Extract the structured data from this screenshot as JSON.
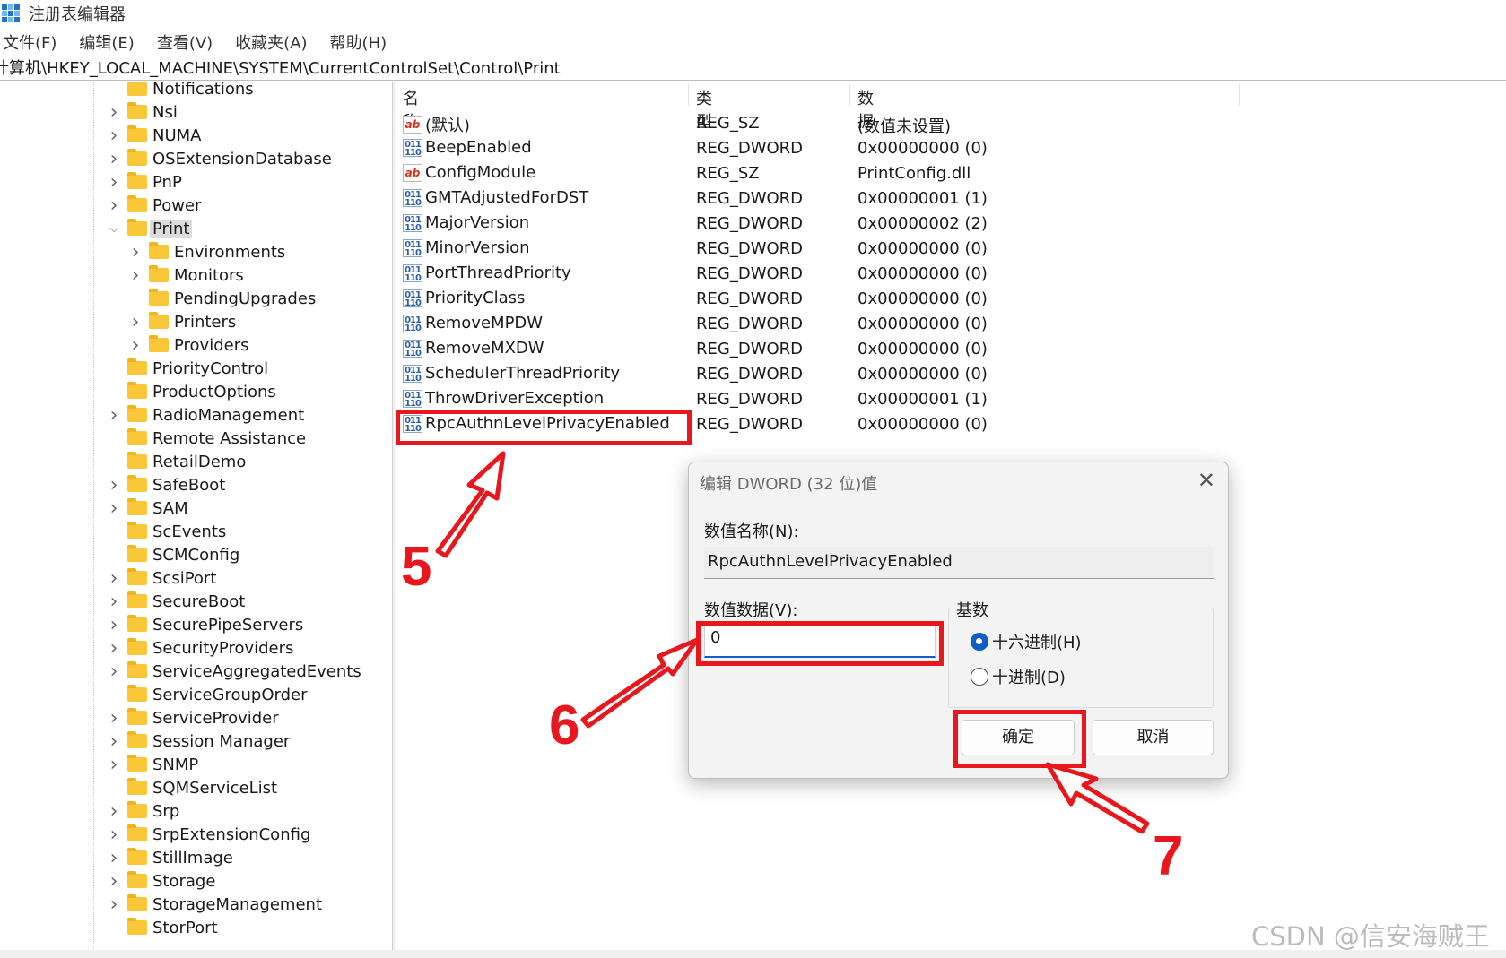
{
  "window": {
    "title": "注册表编辑器",
    "icon": "registry-grid-icon"
  },
  "menu": [
    "文件(F)",
    "编辑(E)",
    "查看(V)",
    "收藏夹(A)",
    "帮助(H)"
  ],
  "address": "计算机\\HKEY_LOCAL_MACHINE\\SYSTEM\\CurrentControlSet\\Control\\Print",
  "tree": [
    {
      "label": "Notifications",
      "level": 0,
      "chevron": "",
      "selected": false
    },
    {
      "label": "Nsi",
      "level": 0,
      "chevron": "right",
      "selected": false
    },
    {
      "label": "NUMA",
      "level": 0,
      "chevron": "right",
      "selected": false
    },
    {
      "label": "OSExtensionDatabase",
      "level": 0,
      "chevron": "right",
      "selected": false
    },
    {
      "label": "PnP",
      "level": 0,
      "chevron": "right",
      "selected": false
    },
    {
      "label": "Power",
      "level": 0,
      "chevron": "right",
      "selected": false
    },
    {
      "label": "Print",
      "level": 0,
      "chevron": "down",
      "selected": true
    },
    {
      "label": "Environments",
      "level": 1,
      "chevron": "right",
      "selected": false
    },
    {
      "label": "Monitors",
      "level": 1,
      "chevron": "right",
      "selected": false
    },
    {
      "label": "PendingUpgrades",
      "level": 1,
      "chevron": "",
      "selected": false
    },
    {
      "label": "Printers",
      "level": 1,
      "chevron": "right",
      "selected": false
    },
    {
      "label": "Providers",
      "level": 1,
      "chevron": "right",
      "selected": false
    },
    {
      "label": "PriorityControl",
      "level": 0,
      "chevron": "",
      "selected": false
    },
    {
      "label": "ProductOptions",
      "level": 0,
      "chevron": "",
      "selected": false
    },
    {
      "label": "RadioManagement",
      "level": 0,
      "chevron": "right",
      "selected": false
    },
    {
      "label": "Remote Assistance",
      "level": 0,
      "chevron": "",
      "selected": false
    },
    {
      "label": "RetailDemo",
      "level": 0,
      "chevron": "",
      "selected": false
    },
    {
      "label": "SafeBoot",
      "level": 0,
      "chevron": "right",
      "selected": false
    },
    {
      "label": "SAM",
      "level": 0,
      "chevron": "right",
      "selected": false
    },
    {
      "label": "ScEvents",
      "level": 0,
      "chevron": "",
      "selected": false
    },
    {
      "label": "SCMConfig",
      "level": 0,
      "chevron": "",
      "selected": false
    },
    {
      "label": "ScsiPort",
      "level": 0,
      "chevron": "right",
      "selected": false
    },
    {
      "label": "SecureBoot",
      "level": 0,
      "chevron": "right",
      "selected": false
    },
    {
      "label": "SecurePipeServers",
      "level": 0,
      "chevron": "right",
      "selected": false
    },
    {
      "label": "SecurityProviders",
      "level": 0,
      "chevron": "right",
      "selected": false
    },
    {
      "label": "ServiceAggregatedEvents",
      "level": 0,
      "chevron": "right",
      "selected": false
    },
    {
      "label": "ServiceGroupOrder",
      "level": 0,
      "chevron": "",
      "selected": false
    },
    {
      "label": "ServiceProvider",
      "level": 0,
      "chevron": "right",
      "selected": false
    },
    {
      "label": "Session Manager",
      "level": 0,
      "chevron": "right",
      "selected": false
    },
    {
      "label": "SNMP",
      "level": 0,
      "chevron": "right",
      "selected": false
    },
    {
      "label": "SQMServiceList",
      "level": 0,
      "chevron": "",
      "selected": false
    },
    {
      "label": "Srp",
      "level": 0,
      "chevron": "right",
      "selected": false
    },
    {
      "label": "SrpExtensionConfig",
      "level": 0,
      "chevron": "right",
      "selected": false
    },
    {
      "label": "StillImage",
      "level": 0,
      "chevron": "right",
      "selected": false
    },
    {
      "label": "Storage",
      "level": 0,
      "chevron": "right",
      "selected": false
    },
    {
      "label": "StorageManagement",
      "level": 0,
      "chevron": "right",
      "selected": false
    },
    {
      "label": "StorPort",
      "level": 0,
      "chevron": "",
      "selected": false
    }
  ],
  "list": {
    "headers": {
      "name": "名称",
      "type": "类型",
      "data": "数据"
    },
    "rows": [
      {
        "name": "(默认)",
        "type": "REG_SZ",
        "data": "(数值未设置)",
        "icon": "string-value-icon"
      },
      {
        "name": "BeepEnabled",
        "type": "REG_DWORD",
        "data": "0x00000000 (0)",
        "icon": "binary-value-icon"
      },
      {
        "name": "ConfigModule",
        "type": "REG_SZ",
        "data": "PrintConfig.dll",
        "icon": "string-value-icon"
      },
      {
        "name": "GMTAdjustedForDST",
        "type": "REG_DWORD",
        "data": "0x00000001 (1)",
        "icon": "binary-value-icon"
      },
      {
        "name": "MajorVersion",
        "type": "REG_DWORD",
        "data": "0x00000002 (2)",
        "icon": "binary-value-icon"
      },
      {
        "name": "MinorVersion",
        "type": "REG_DWORD",
        "data": "0x00000000 (0)",
        "icon": "binary-value-icon"
      },
      {
        "name": "PortThreadPriority",
        "type": "REG_DWORD",
        "data": "0x00000000 (0)",
        "icon": "binary-value-icon"
      },
      {
        "name": "PriorityClass",
        "type": "REG_DWORD",
        "data": "0x00000000 (0)",
        "icon": "binary-value-icon"
      },
      {
        "name": "RemoveMPDW",
        "type": "REG_DWORD",
        "data": "0x00000000 (0)",
        "icon": "binary-value-icon"
      },
      {
        "name": "RemoveMXDW",
        "type": "REG_DWORD",
        "data": "0x00000000 (0)",
        "icon": "binary-value-icon"
      },
      {
        "name": "SchedulerThreadPriority",
        "type": "REG_DWORD",
        "data": "0x00000000 (0)",
        "icon": "binary-value-icon"
      },
      {
        "name": "ThrowDriverException",
        "type": "REG_DWORD",
        "data": "0x00000001 (1)",
        "icon": "binary-value-icon"
      },
      {
        "name": "RpcAuthnLevelPrivacyEnabled",
        "type": "REG_DWORD",
        "data": "0x00000000 (0)",
        "icon": "binary-value-icon"
      }
    ]
  },
  "dialog": {
    "title": "编辑 DWORD (32 位)值",
    "name_label": "数值名称(N):",
    "name_value": "RpcAuthnLevelPrivacyEnabled",
    "data_label": "数值数据(V):",
    "data_value": "0",
    "base_label": "基数",
    "radio_hex": "十六进制(H)",
    "radio_dec": "十进制(D)",
    "selected_base": "hex",
    "ok": "确定",
    "cancel": "取消"
  },
  "annotations": {
    "step5": "5",
    "step6": "6",
    "step7": "7",
    "color": "#e8161d"
  },
  "watermark": "CSDN @信安海贼王"
}
